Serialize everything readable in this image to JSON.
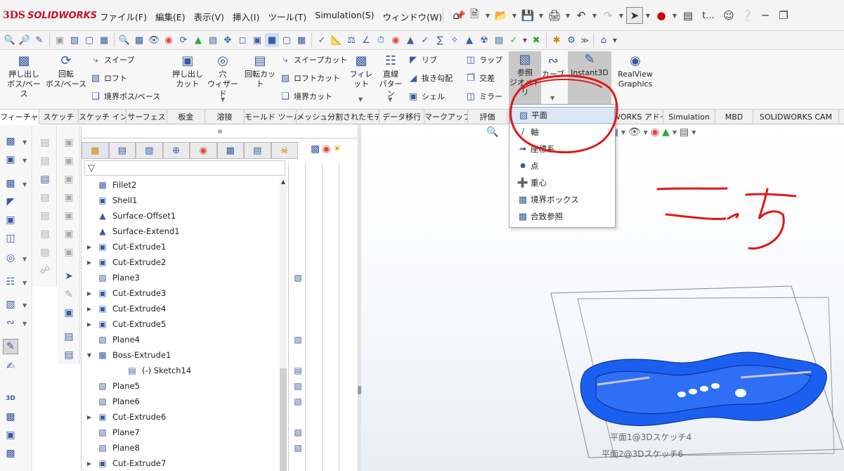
{
  "app": {
    "brand_prefix": "3DS",
    "brand_name": "SOLIDWORKS"
  },
  "menu": [
    "ファイル(F)",
    "編集(E)",
    "表示(V)",
    "挿入(I)",
    "ツール(T)",
    "Simulation(S)",
    "ウィンドウ(W)"
  ],
  "qat_text": "t...",
  "ribbon": {
    "extrude_boss": "押し出し\nボス/ベース",
    "revolve_boss": "回転\nボス/ベース",
    "sweep": "スイープ",
    "loft": "ロフト",
    "boundary_boss": "境界ボス/ベース",
    "extrude_cut": "押し出し\nカット",
    "hole_wizard": "穴\nウィザード",
    "revolve_cut": "回転カット",
    "sweep_cut": "スイープカット",
    "loft_cut": "ロフトカット",
    "boundary_cut": "境界カット",
    "fillet": "フィレット",
    "linear_pattern": "直線\nパターン",
    "rib": "リブ",
    "draft": "抜き勾配",
    "shell": "シェル",
    "wrap": "ラップ",
    "intersect": "交差",
    "mirror": "ミラー",
    "ref_geometry": "参照\nジオメトリ",
    "curves": "カーブ",
    "instant3d": "Instant3D",
    "realview": "RealView\nGraphics"
  },
  "tabs": [
    "フィーチャー",
    "スケッチ",
    "スケッチ インク",
    "サーフェス",
    "板金",
    "溶接",
    "モールド ツール",
    "メッシュ分割されたモデル",
    "データ移行",
    "マークアップ",
    "評価",
    "WORKS アドイン",
    "Simulation",
    "MBD",
    "SOLIDWORKS CAM"
  ],
  "feature_tree": [
    {
      "label": "Fillet2",
      "icon": "fillet-icon",
      "expandable": false
    },
    {
      "label": "Shell1",
      "icon": "shell-icon",
      "expandable": false
    },
    {
      "label": "Surface-Offset1",
      "icon": "surface-offset-icon",
      "expandable": false
    },
    {
      "label": "Surface-Extend1",
      "icon": "surface-extend-icon",
      "expandable": false
    },
    {
      "label": "Cut-Extrude1",
      "icon": "cut-extrude-icon",
      "expandable": true
    },
    {
      "label": "Cut-Extrude2",
      "icon": "cut-extrude-icon",
      "expandable": true
    },
    {
      "label": "Plane3",
      "icon": "plane-icon",
      "expandable": false
    },
    {
      "label": "Cut-Extrude3",
      "icon": "cut-extrude-icon",
      "expandable": true
    },
    {
      "label": "Cut-Extrude4",
      "icon": "cut-extrude-icon",
      "expandable": true
    },
    {
      "label": "Cut-Extrude5",
      "icon": "cut-extrude-icon",
      "expandable": true
    },
    {
      "label": "Plane4",
      "icon": "plane-icon",
      "expandable": false
    },
    {
      "label": "Boss-Extrude1",
      "icon": "boss-extrude-icon",
      "expandable": true
    },
    {
      "label": "(-) Sketch14",
      "icon": "sketch-icon",
      "expandable": false
    },
    {
      "label": "Plane5",
      "icon": "plane-icon",
      "expandable": false
    },
    {
      "label": "Plane6",
      "icon": "plane-icon",
      "expandable": false
    },
    {
      "label": "Cut-Extrude6",
      "icon": "cut-extrude-icon",
      "expandable": true
    },
    {
      "label": "Plane7",
      "icon": "plane-icon",
      "expandable": false
    },
    {
      "label": "Plane8",
      "icon": "plane-icon",
      "expandable": false
    },
    {
      "label": "Cut-Extrude7",
      "icon": "cut-extrude-icon",
      "expandable": true
    }
  ],
  "dropdown": {
    "items": [
      {
        "label": "平面",
        "icon": "plane-icon"
      },
      {
        "label": "軸",
        "icon": "axis-icon"
      },
      {
        "label": "座標系",
        "icon": "coordinate-system-icon"
      },
      {
        "label": "点",
        "icon": "point-icon"
      },
      {
        "label": "重心",
        "icon": "center-of-mass-icon"
      },
      {
        "label": "境界ボックス",
        "icon": "bounding-box-icon"
      },
      {
        "label": "合致参照",
        "icon": "mate-reference-icon"
      }
    ]
  },
  "viewport": {
    "plane_labels": [
      "平面1@3Dスケッチ4",
      "平面2@3Dスケッチ6"
    ]
  },
  "colors": {
    "brand": "#c8102e",
    "model": "#1a5ff0",
    "annotation": "#e01818",
    "highlight": "#dce7f5"
  }
}
